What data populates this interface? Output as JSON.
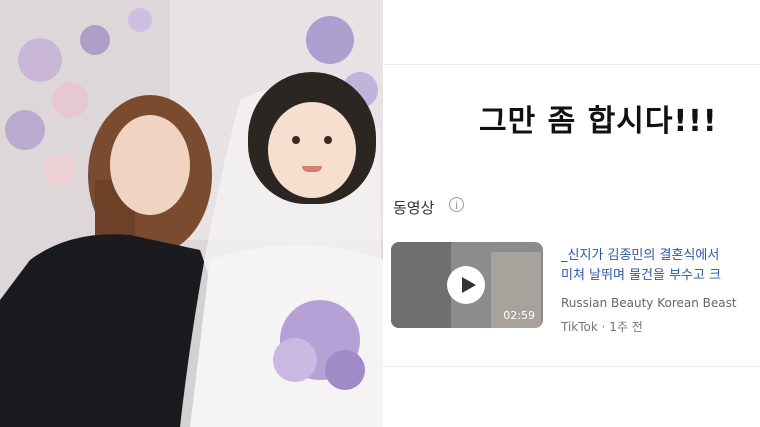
{
  "right_panel": {
    "headline": "그만 좀 합시다!!!",
    "section_label": "동영상",
    "info_symbol": "i",
    "video": {
      "title_line1": "_신지가 김종민의 결혼식에서",
      "title_line2": "미쳐 날뛰며 물건을 부수고 크",
      "channel": "Russian Beauty Korean Beast",
      "meta": "TikTok · 1주 전",
      "duration": "02:59"
    }
  },
  "photo": {
    "face_emoji": "👰🏻‍♀️"
  },
  "colors": {
    "link": "#2a58a8",
    "headline": "#111111",
    "muted": "#777777"
  }
}
